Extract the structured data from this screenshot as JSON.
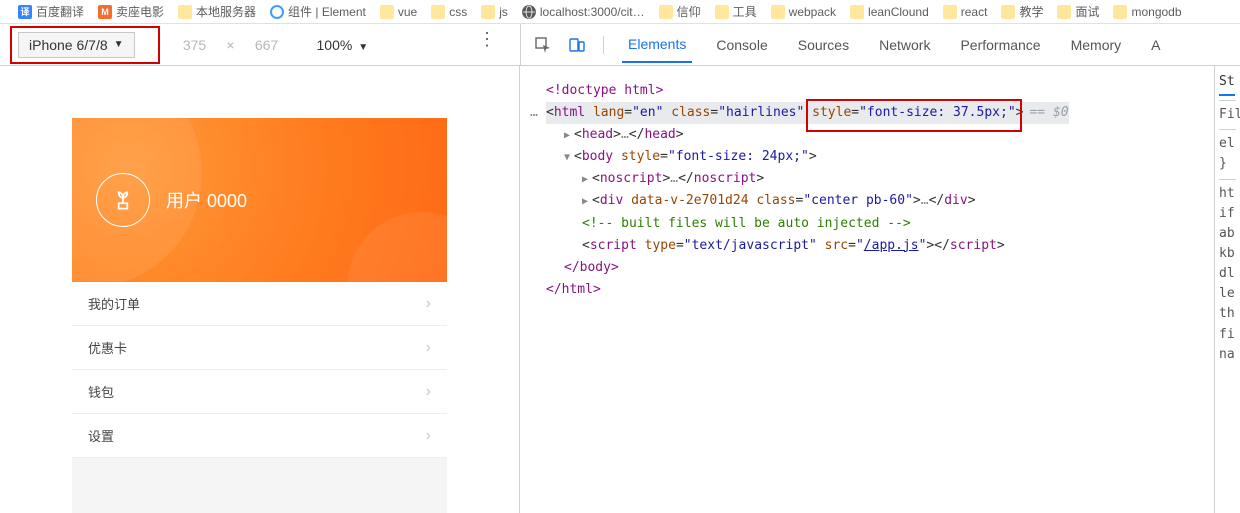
{
  "bookmarks": [
    {
      "label": "百度翻译",
      "icon": "baidu"
    },
    {
      "label": "卖座电影",
      "icon": "maiz"
    },
    {
      "label": "本地服务器",
      "icon": "folder"
    },
    {
      "label": "组件 | Element",
      "icon": "elem"
    },
    {
      "label": "vue",
      "icon": "folder"
    },
    {
      "label": "css",
      "icon": "folder"
    },
    {
      "label": "js",
      "icon": "folder"
    },
    {
      "label": "localhost:3000/cit…",
      "icon": "local"
    },
    {
      "label": "信仰",
      "icon": "folder"
    },
    {
      "label": "工具",
      "icon": "folder"
    },
    {
      "label": "webpack",
      "icon": "folder"
    },
    {
      "label": "leanClound",
      "icon": "folder"
    },
    {
      "label": "react",
      "icon": "folder"
    },
    {
      "label": "教学",
      "icon": "folder"
    },
    {
      "label": "面试",
      "icon": "folder"
    },
    {
      "label": "mongodb",
      "icon": "folder"
    }
  ],
  "deviceBar": {
    "device": "iPhone 6/7/8",
    "width": "375",
    "height": "667",
    "zoom": "100%"
  },
  "devTabs": {
    "elements": "Elements",
    "console": "Console",
    "sources": "Sources",
    "network": "Network",
    "performance": "Performance",
    "memory": "Memory",
    "extra": "A"
  },
  "preview": {
    "userLabel": "用户 0000",
    "menu": [
      "我的订单",
      "优惠卡",
      "钱包",
      "设置"
    ]
  },
  "dom": {
    "doctype": "<!doctype html>",
    "htmlOpen_pre": "<html lang=\"en\" class=\"hairlines\" ",
    "htmlOpen_style": "style=\"font-size: 37.5px;\"",
    "htmlOpen_post": ">",
    "eqDollar": "== $0",
    "head": "<head>…</head>",
    "bodyOpen": "<body style=\"font-size: 24px;\">",
    "noscript": "<noscript>…</noscript>",
    "div1": "<div data-v-2e701d24 class=\"center pb-60\">…</div>",
    "comment": "<!-- built files will be auto injected -->",
    "script": "<script type=\"text/javascript\" src=\"/app.js\"></script>",
    "scriptSrc": "/app.js",
    "bodyClose": "</body>",
    "htmlClose": "</html>"
  },
  "stylesSide": {
    "tab": "St",
    "filter": "Fil",
    "el": "el",
    "brace": "}",
    "lines": [
      "ht",
      "if",
      "ab",
      "kb",
      "dl",
      "le",
      "th",
      "fi",
      "na"
    ]
  }
}
